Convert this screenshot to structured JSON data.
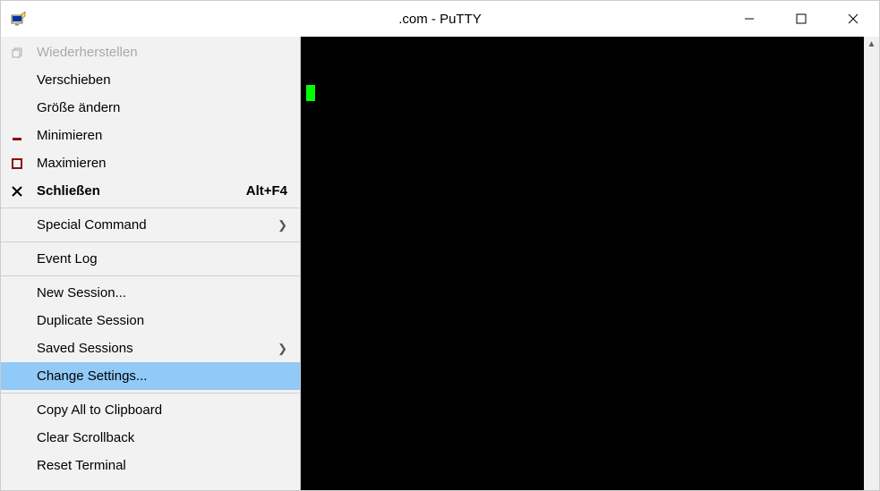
{
  "title": ".com - PuTTY",
  "menu": {
    "restore": "Wiederherstellen",
    "move": "Verschieben",
    "size": "Größe ändern",
    "minimize": "Minimieren",
    "maximize": "Maximieren",
    "close": "Schließen",
    "close_shortcut": "Alt+F4",
    "special_command": "Special Command",
    "event_log": "Event Log",
    "new_session": "New Session...",
    "duplicate_session": "Duplicate Session",
    "saved_sessions": "Saved Sessions",
    "change_settings": "Change Settings...",
    "copy_all": "Copy All to Clipboard",
    "clear_scrollback": "Clear Scrollback",
    "reset_terminal": "Reset Terminal"
  }
}
